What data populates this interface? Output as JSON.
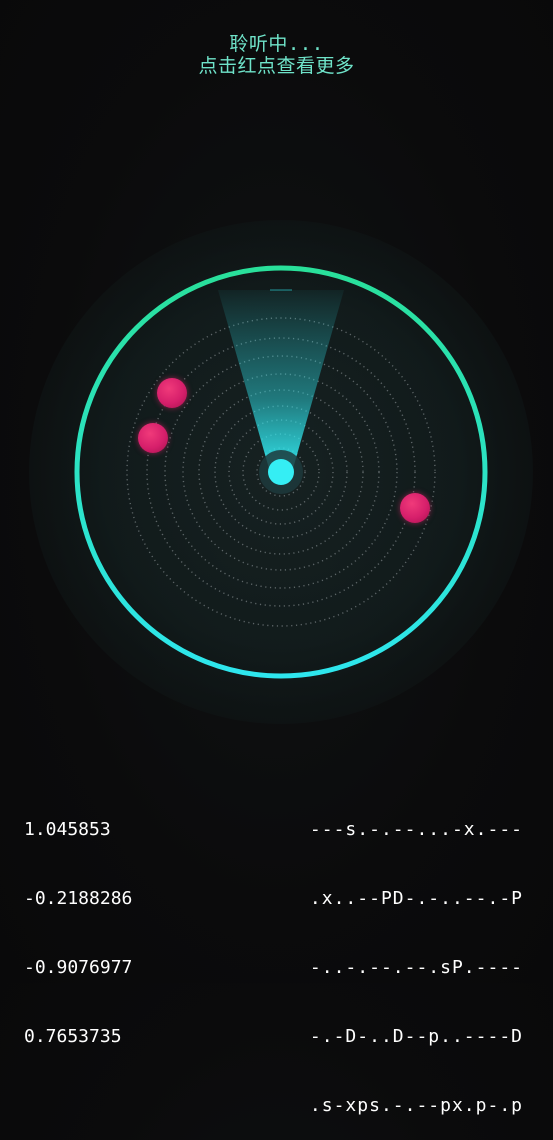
{
  "status": {
    "line1": "聆听中...",
    "line2": "点击红点查看更多"
  },
  "colors": {
    "ring_top": "#29e09a",
    "ring_bottom": "#2ee6ee",
    "beam": "#2fe8f0",
    "target_dot": "#e0226e",
    "grid": "#9aa3a6",
    "text_accent": "#6fe3c9"
  },
  "targets": [
    {
      "name": "target-dot-1",
      "angle_deg": -54,
      "radius_frac": 0.66
    },
    {
      "name": "target-dot-2",
      "angle_deg": -75,
      "radius_frac": 0.65
    },
    {
      "name": "target-dot-3",
      "angle_deg": 105,
      "radius_frac": 0.68
    }
  ],
  "readouts": {
    "numbers": [
      "1.045853",
      "-0.2188286",
      "-0.9076977",
      "0.7653735"
    ],
    "codes": [
      "---s.-.--...-x.---",
      ".x..--PD-.-..--.-P",
      "-..-.--.--.sP.----",
      "-.-D-..D--p..----D",
      ".s-xps.-.--px.p-.p"
    ]
  }
}
